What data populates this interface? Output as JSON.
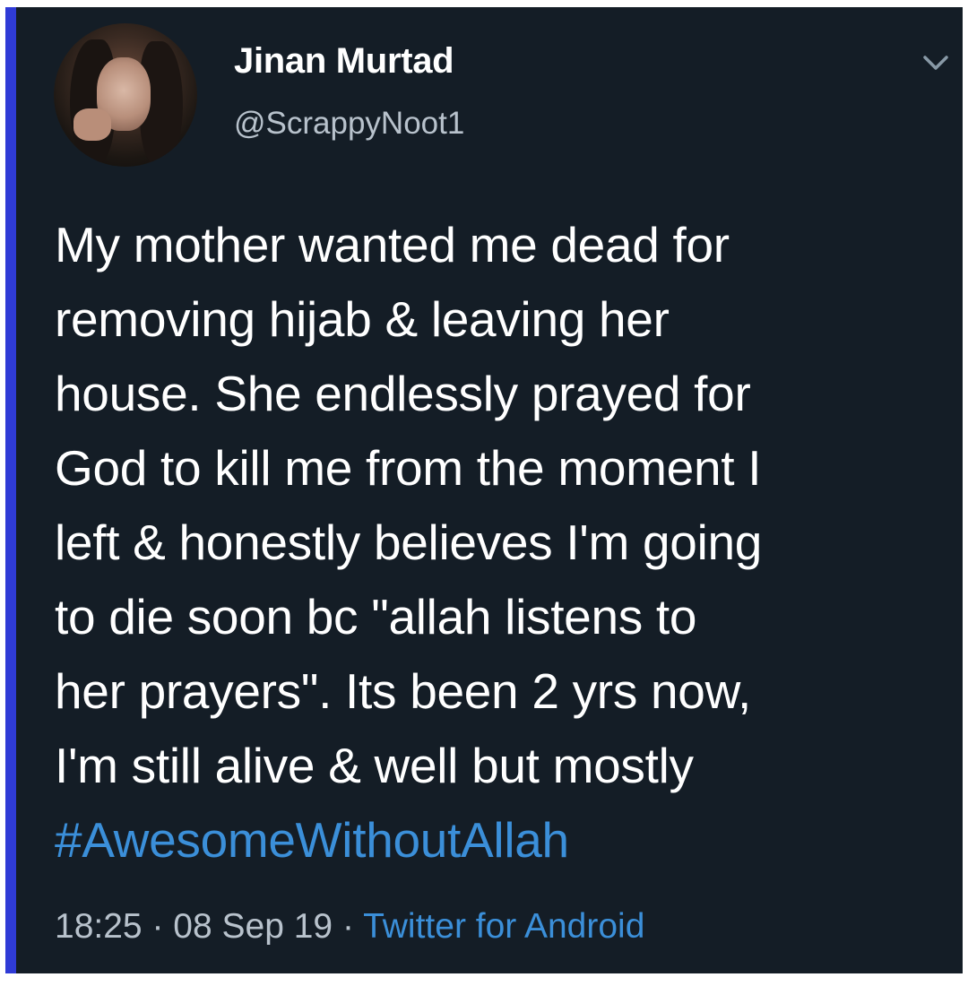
{
  "tweet": {
    "author": {
      "name": "Jinan Murtad",
      "handle": "@ScrappyNoot1"
    },
    "lines": [
      "My mother wanted me dead for",
      "removing hijab & leaving her",
      "house. She endlessly prayed for",
      "God to kill me from the moment I",
      "left & honestly believes I'm going",
      "to die soon bc \"allah listens to",
      "her prayers\". Its been 2 yrs now,",
      "I'm still alive & well but mostly"
    ],
    "hashtag": "#AwesomeWithoutAllah",
    "meta": {
      "time": "18:25",
      "separator_1": " · ",
      "date": "08 Sep 19",
      "separator_2": " · ",
      "source": "Twitter for Android"
    }
  },
  "icons": {
    "menu": "chevron-down-icon",
    "avatar": "avatar"
  },
  "colors": {
    "background": "#141d26",
    "accent_border": "#2f3bd6",
    "text": "#ffffff",
    "secondary_text": "#b8c2cc",
    "link": "#3b8fd9"
  }
}
